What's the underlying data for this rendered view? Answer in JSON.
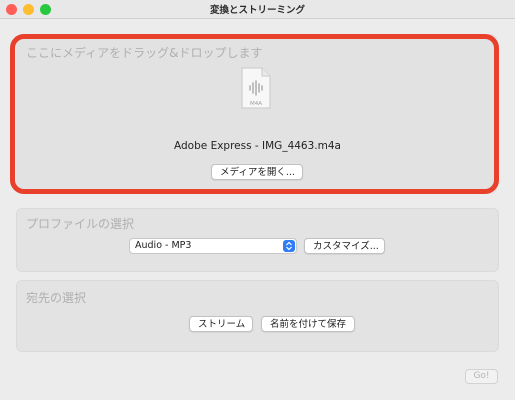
{
  "window": {
    "title": "変換とストリーミング"
  },
  "media_section": {
    "label": "ここにメディアをドラッグ&ドロップします",
    "file_icon_label": "M4A",
    "file_name": "Adobe Express - IMG_4463.m4a",
    "open_media_button": "メディアを開く..."
  },
  "profile_section": {
    "label": "プロファイルの選択",
    "selected_profile": "Audio - MP3",
    "customize_button": "カスタマイズ..."
  },
  "destination_section": {
    "label": "宛先の選択",
    "stream_button": "ストリーム",
    "save_as_button": "名前を付けて保存"
  },
  "footer": {
    "go_button": "Go!"
  },
  "colors": {
    "highlight_border": "#e8402a",
    "select_accent": "#2f7cf6"
  }
}
